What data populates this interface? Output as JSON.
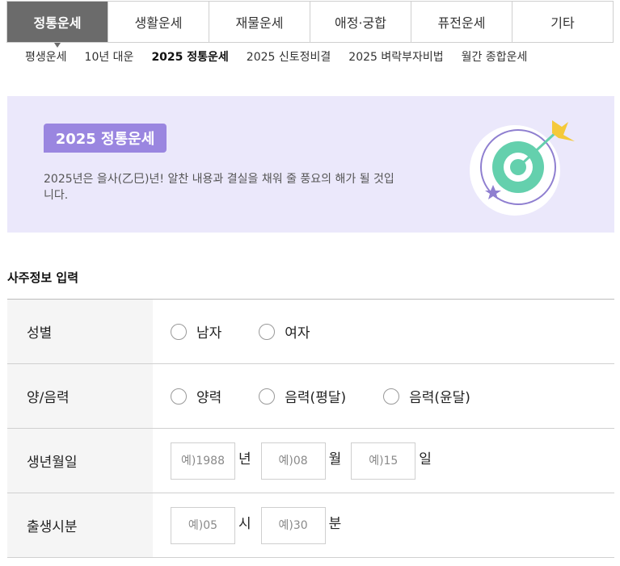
{
  "tabs": [
    "정통운세",
    "생활운세",
    "재물운세",
    "애정·궁합",
    "퓨전운세",
    "기타"
  ],
  "active_tab": 0,
  "subnav": [
    "평생운세",
    "10년 대운",
    "2025 정통운세",
    "2025 신토정비결",
    "2025 벼락부자비법",
    "월간 종합운세"
  ],
  "active_subnav": 2,
  "banner": {
    "badge": "2025 정통운세",
    "description": "2025년은 을사(乙巳)년! 알찬 내용과 결실을 채워 줄 풍요의 해가 될 것입니다."
  },
  "section_title": "사주정보 입력",
  "form": {
    "gender": {
      "label": "성별",
      "options": [
        "남자",
        "여자"
      ]
    },
    "calendar": {
      "label": "양/음력",
      "options": [
        "양력",
        "음력(평달)",
        "음력(윤달)"
      ]
    },
    "birthdate": {
      "label": "생년월일",
      "year_placeholder": "예)1988",
      "year_unit": "년",
      "month_placeholder": "예)08",
      "month_unit": "월",
      "day_placeholder": "예)15",
      "day_unit": "일"
    },
    "birthtime": {
      "label": "출생시분",
      "hour_placeholder": "예)05",
      "hour_unit": "시",
      "minute_placeholder": "예)30",
      "minute_unit": "분"
    }
  },
  "colors": {
    "accent": "#9a86e0",
    "banner_bg": "#ebe8fb",
    "active_tab": "#6b6b6b"
  }
}
